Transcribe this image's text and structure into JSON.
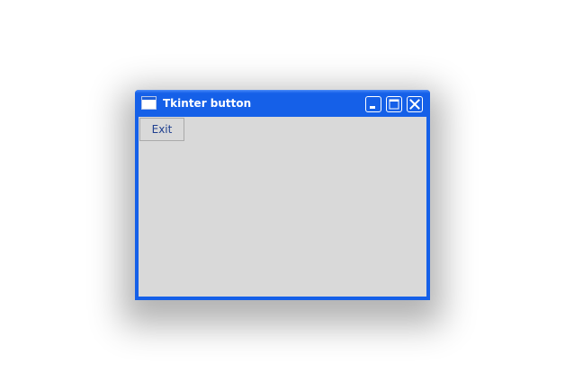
{
  "window": {
    "title": "Tkinter button",
    "controls": {
      "minimize_icon": "minimize-icon",
      "maximize_icon": "maximize-icon",
      "close_icon": "close-icon"
    }
  },
  "client": {
    "exit_button_label": "Exit"
  },
  "colors": {
    "titlebar": "#1560e8",
    "client_background": "#d9d9d9",
    "button_text": "#1f3f8f",
    "desktop": "#ffffff"
  }
}
